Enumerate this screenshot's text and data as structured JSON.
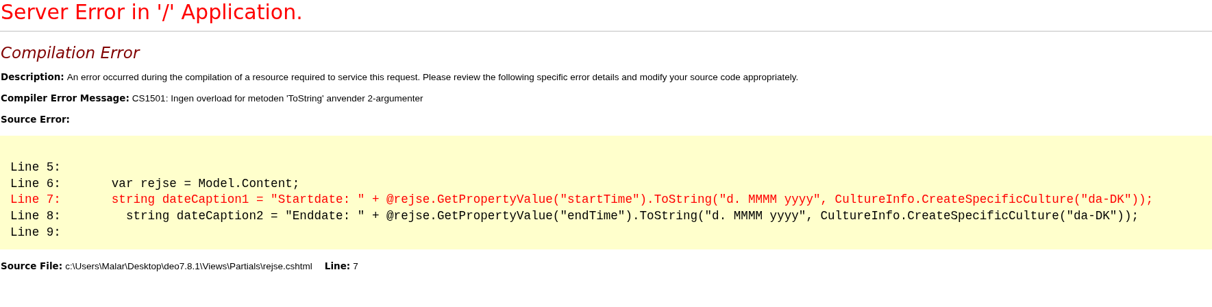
{
  "title": "Server Error in '/' Application.",
  "error_heading": "Compilation Error",
  "fields": [
    {
      "label": "Description:",
      "value": "An error occurred during the compilation of a resource required to service this request. Please review the following specific error details and modify your source code appropriately."
    },
    {
      "label": "Compiler Error Message:",
      "value": "CS1501: Ingen overload for metoden 'ToString' anvender 2-argumenter"
    }
  ],
  "source_error_label": "Source Error:",
  "source_lines": [
    {
      "text": "Line 5:",
      "highlighted": false
    },
    {
      "text": "Line 6:       var rejse = Model.Content;",
      "highlighted": false
    },
    {
      "text": "Line 7:       string dateCaption1 = \"Startdate: \" + @rejse.GetPropertyValue(\"startTime\").ToString(\"d. MMMM yyyy\", CultureInfo.CreateSpecificCulture(\"da-DK\"));",
      "highlighted": true
    },
    {
      "text": "Line 8:         string dateCaption2 = \"Enddate: \" + @rejse.GetPropertyValue(\"endTime\").ToString(\"d. MMMM yyyy\", CultureInfo.CreateSpecificCulture(\"da-DK\"));",
      "highlighted": false
    },
    {
      "text": "Line 9:",
      "highlighted": false
    }
  ],
  "source_file": {
    "label": "Source File:",
    "value": "c:\\Users\\Malar\\Desktop\\deo7.8.1\\Views\\Partials\\rejse.cshtml",
    "line_label": "Line:",
    "line_value": "7"
  }
}
